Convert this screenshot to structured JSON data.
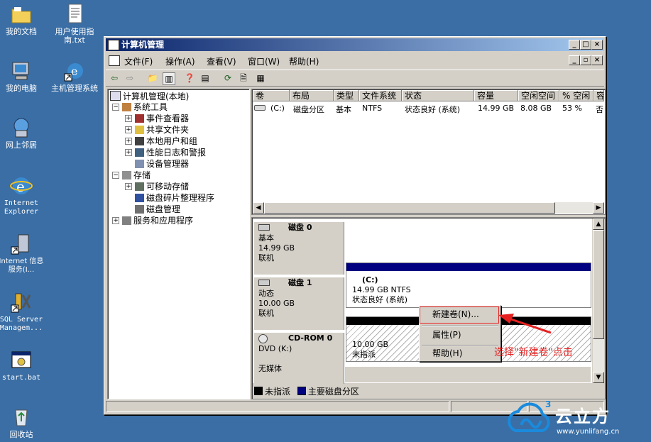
{
  "desktop": {
    "icons": [
      {
        "label": "我的文档"
      },
      {
        "label": "用户使用指南.txt"
      },
      {
        "label": "我的电脑"
      },
      {
        "label": "主机管理系统"
      },
      {
        "label": "网上邻居"
      },
      {
        "label": "Internet Explorer"
      },
      {
        "label": "Internet 信息服务(I..."
      },
      {
        "label": "SQL Server Managem..."
      },
      {
        "label": "start.bat"
      },
      {
        "label": "回收站"
      }
    ]
  },
  "window": {
    "title": "计算机管理",
    "menus": [
      "文件(F)",
      "操作(A)",
      "查看(V)",
      "窗口(W)",
      "帮助(H)"
    ]
  },
  "tree": {
    "root": "计算机管理(本地)",
    "system_tools": "系统工具",
    "event_viewer": "事件查看器",
    "shared_folders": "共享文件夹",
    "local_users": "本地用户和组",
    "perf_logs": "性能日志和警报",
    "device_manager": "设备管理器",
    "storage": "存储",
    "removable": "可移动存储",
    "defrag": "磁盘碎片整理程序",
    "disk_mgmt": "磁盘管理",
    "services": "服务和应用程序"
  },
  "volume_list": {
    "columns": [
      "卷",
      "布局",
      "类型",
      "文件系统",
      "状态",
      "容量",
      "空闲空间",
      "% 空闲",
      "容"
    ],
    "rows": [
      {
        "vol": "(C:)",
        "layout": "磁盘分区",
        "type": "基本",
        "fs": "NTFS",
        "status": "状态良好 (系统)",
        "capacity": "14.99 GB",
        "free": "8.08 GB",
        "pct": "53 %",
        "fault": "否"
      }
    ]
  },
  "disks": [
    {
      "name": "磁盘 0",
      "kind": "基本",
      "size": "14.99 GB",
      "state": "联机",
      "vol_label": "(C:)",
      "vol_line": "14.99 GB NTFS",
      "vol_status": "状态良好 (系统)"
    },
    {
      "name": "磁盘 1",
      "kind": "动态",
      "size": "10.00 GB",
      "state": "联机",
      "vol_size": "10.00 GB",
      "vol_status": "未指派"
    },
    {
      "name": "CD-ROM 0",
      "kind": "DVD (K:)",
      "state": "无媒体"
    }
  ],
  "legend": {
    "unallocated": "未指派",
    "primary": "主要磁盘分区"
  },
  "context_menu": {
    "new_volume": "新建卷(N)...",
    "properties": "属性(P)",
    "help": "帮助(H)"
  },
  "annotation": "选择\"新建卷\"点击",
  "watermark": {
    "brand": "云立方",
    "url": "www.yunlifang.cn",
    "badge": "3"
  },
  "colors": {
    "desktop": "#3a6ea5",
    "title": "#0a246a",
    "primary_partition": "#000080",
    "unallocated": "#000000",
    "annotation": "#e62020"
  }
}
